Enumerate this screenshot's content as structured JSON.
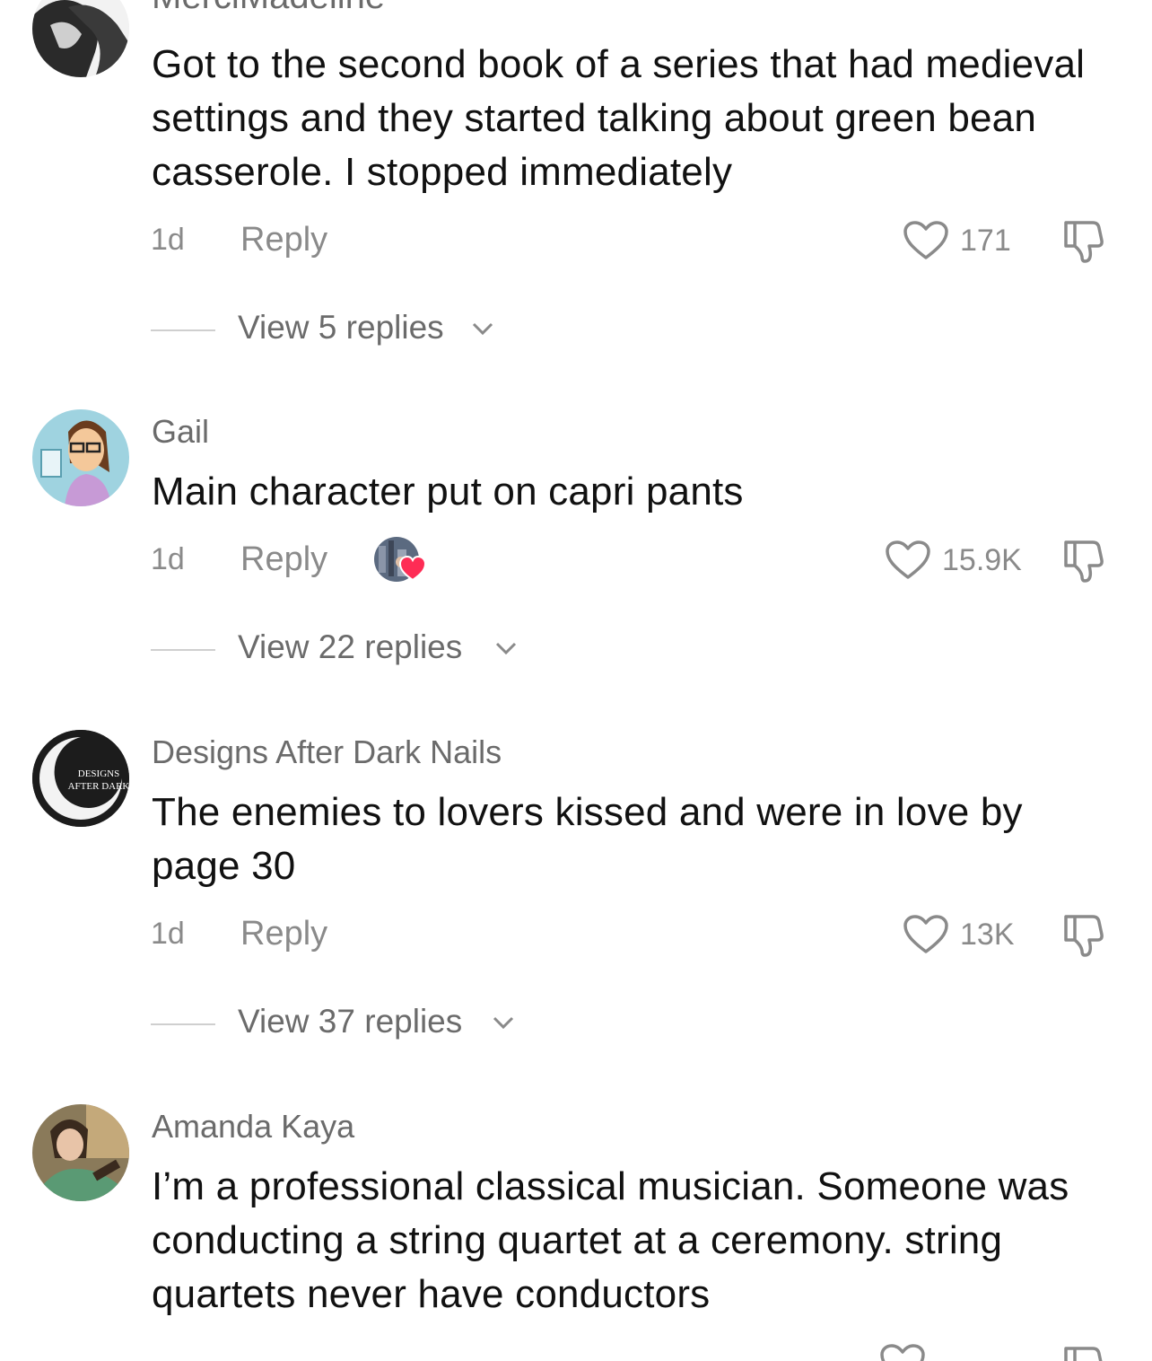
{
  "comments": [
    {
      "username": "MerciMadeline",
      "text": "Got to the second book of a series that had medieval settings and they started talking about green bean casserole. I stopped immediately",
      "time": "1d",
      "reply_label": "Reply",
      "likes": "171",
      "view_replies": "View 5 replies"
    },
    {
      "username": "Gail",
      "text": "Main character put on capri pants",
      "time": "1d",
      "reply_label": "Reply",
      "likes": "15.9K",
      "view_replies": "View 22 replies"
    },
    {
      "username": "Designs After Dark Nails",
      "avatar_text_1": "DESIGNS",
      "avatar_text_2": "AFTER DARK",
      "text": "The enemies to lovers kissed and were in love by page 30",
      "time": "1d",
      "reply_label": "Reply",
      "likes": "13K",
      "view_replies": "View 37 replies"
    },
    {
      "username": "Amanda Kaya",
      "text": "I’m a professional classical musician. Someone was conducting a string quartet at a ceremony. string quartets never have conductors"
    }
  ],
  "icons": {
    "heart": "heart-outline-icon",
    "dislike": "thumbs-down-icon",
    "chevron": "chevron-down-icon",
    "creator_liked": "red-heart-icon"
  },
  "colors": {
    "text": "#111111",
    "secondary": "#8a8a8a",
    "creator_heart": "#fe2c55"
  }
}
